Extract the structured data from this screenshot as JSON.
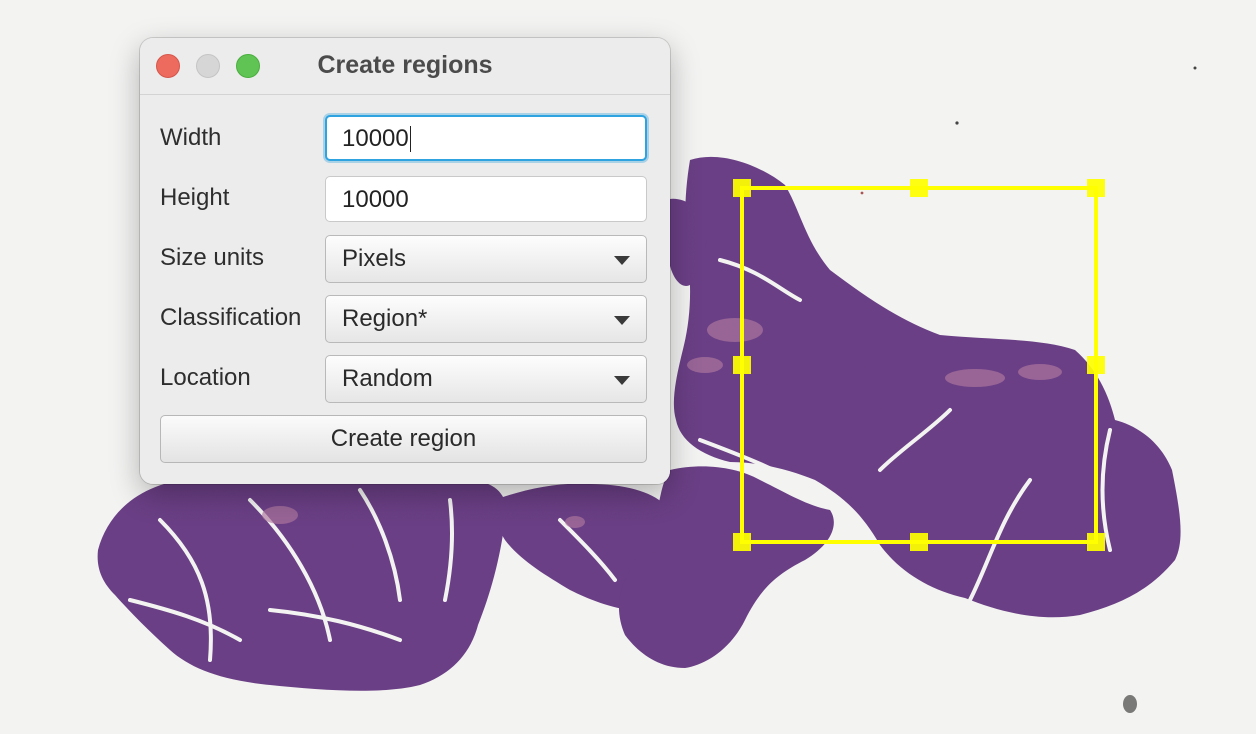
{
  "dialog": {
    "title": "Create regions",
    "fields": {
      "width": {
        "label": "Width",
        "value": "10000"
      },
      "height": {
        "label": "Height",
        "value": "10000"
      },
      "size_units": {
        "label": "Size units",
        "value": "Pixels"
      },
      "classification": {
        "label": "Classification",
        "value": "Region*"
      },
      "location": {
        "label": "Location",
        "value": "Random"
      }
    },
    "create_button": "Create region"
  },
  "viewer": {
    "tissue_color": "#6b3f86",
    "background_color": "#f3f3f2",
    "annotation_color": "#ffff00"
  }
}
